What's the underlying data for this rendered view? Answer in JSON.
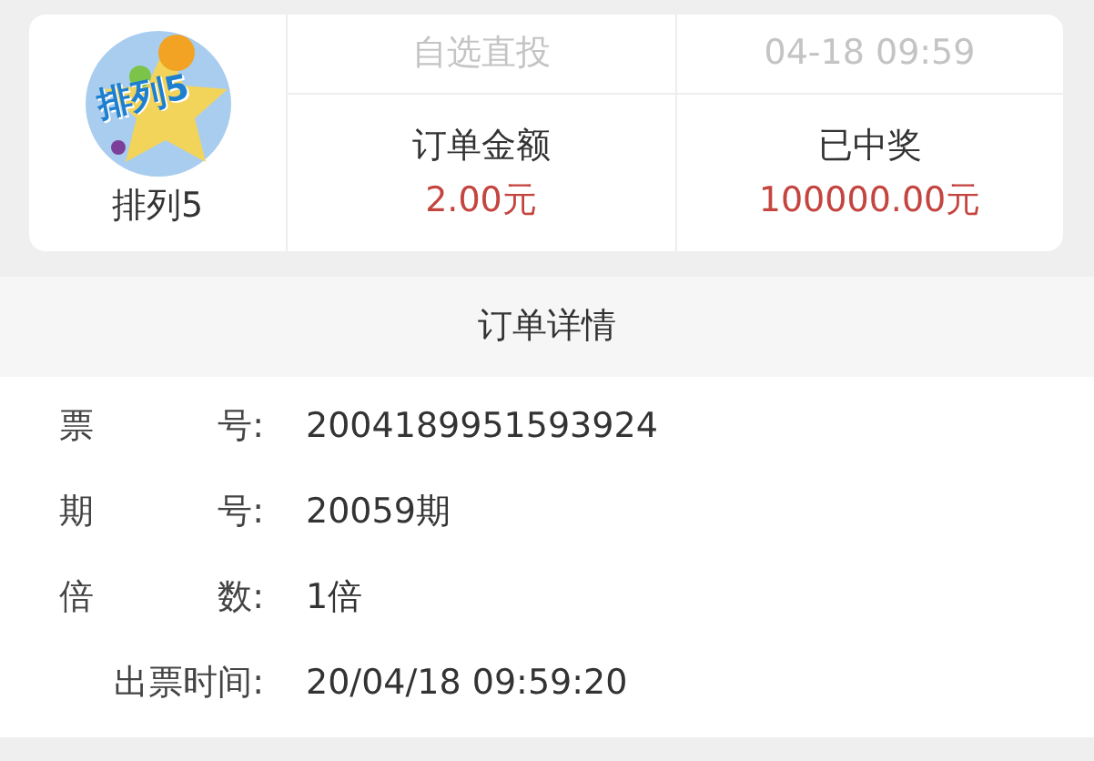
{
  "lottery": {
    "logo_text": "排列5",
    "name": "排列5"
  },
  "order_summary": {
    "play_type": "自选直投",
    "time": "04-18 09:59",
    "amount_label": "订单金额",
    "amount": "2.00元",
    "prize_label": "已中奖",
    "prize": "100000.00元"
  },
  "details": {
    "title": "订单详情",
    "rows": [
      {
        "label": "票 号:",
        "value": "2004189951593924"
      },
      {
        "label": "期 号:",
        "value": "20059期"
      },
      {
        "label": "倍 数:",
        "value": "1倍"
      },
      {
        "label": "出票时间:",
        "value": "20/04/18 09:59:20"
      }
    ]
  }
}
